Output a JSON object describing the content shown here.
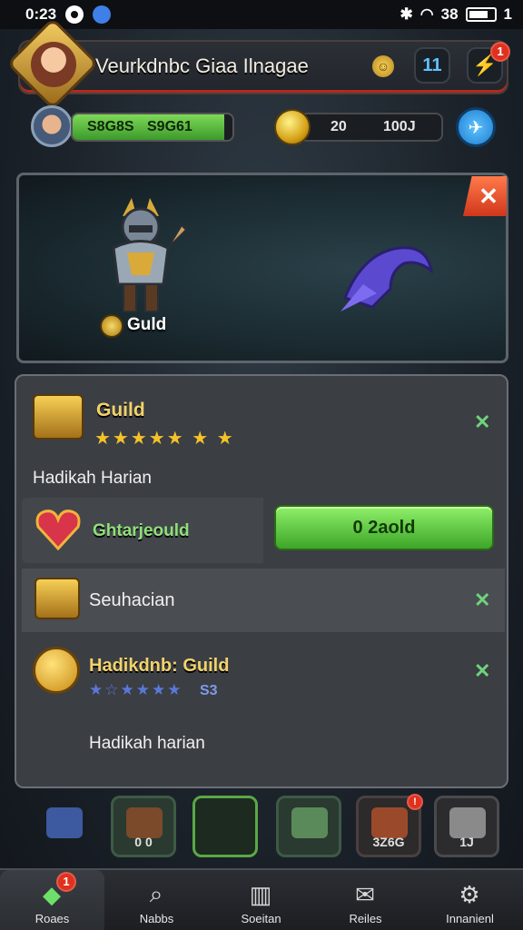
{
  "status_bar": {
    "time": "0:23",
    "signal_text": "38",
    "battery_level": "1"
  },
  "header": {
    "title": "Veurkdnbc Giaa Ilnagae",
    "pause_label": "11",
    "notification_count": "1"
  },
  "resources": {
    "xp_left": "S8G8S",
    "xp_right": "S9G61",
    "xp_fill": 0.95,
    "gold_left": "20",
    "gold_right": "100J"
  },
  "banner": {
    "label": "Guld"
  },
  "guild_card": {
    "title": "Guild",
    "stars": "★★★★★ ★ ★",
    "subtitle": "Hadikah Harian"
  },
  "reward_row": {
    "label": "Ghtarjeould",
    "button_label": "0 2aold"
  },
  "search_row": {
    "label": "Seuhacian"
  },
  "guild_card_2": {
    "title": "Hadikdnb: Guild",
    "stars": "★☆★★★★",
    "stars_count": "S3",
    "subtitle": "Hadikah harian"
  },
  "inventory": [
    {
      "label": ""
    },
    {
      "label": "0   0"
    },
    {
      "label": ""
    },
    {
      "label": ""
    },
    {
      "label": "3Z6G"
    },
    {
      "label": "1J"
    }
  ],
  "nav": [
    {
      "label": "Roaes",
      "icon": "gem-icon",
      "badge": "1"
    },
    {
      "label": "Nabbs",
      "icon": "search-icon"
    },
    {
      "label": "Soeitan",
      "icon": "building-icon"
    },
    {
      "label": "Reiles",
      "icon": "mail-icon"
    },
    {
      "label": "Innanienl",
      "icon": "gear-icon"
    }
  ]
}
